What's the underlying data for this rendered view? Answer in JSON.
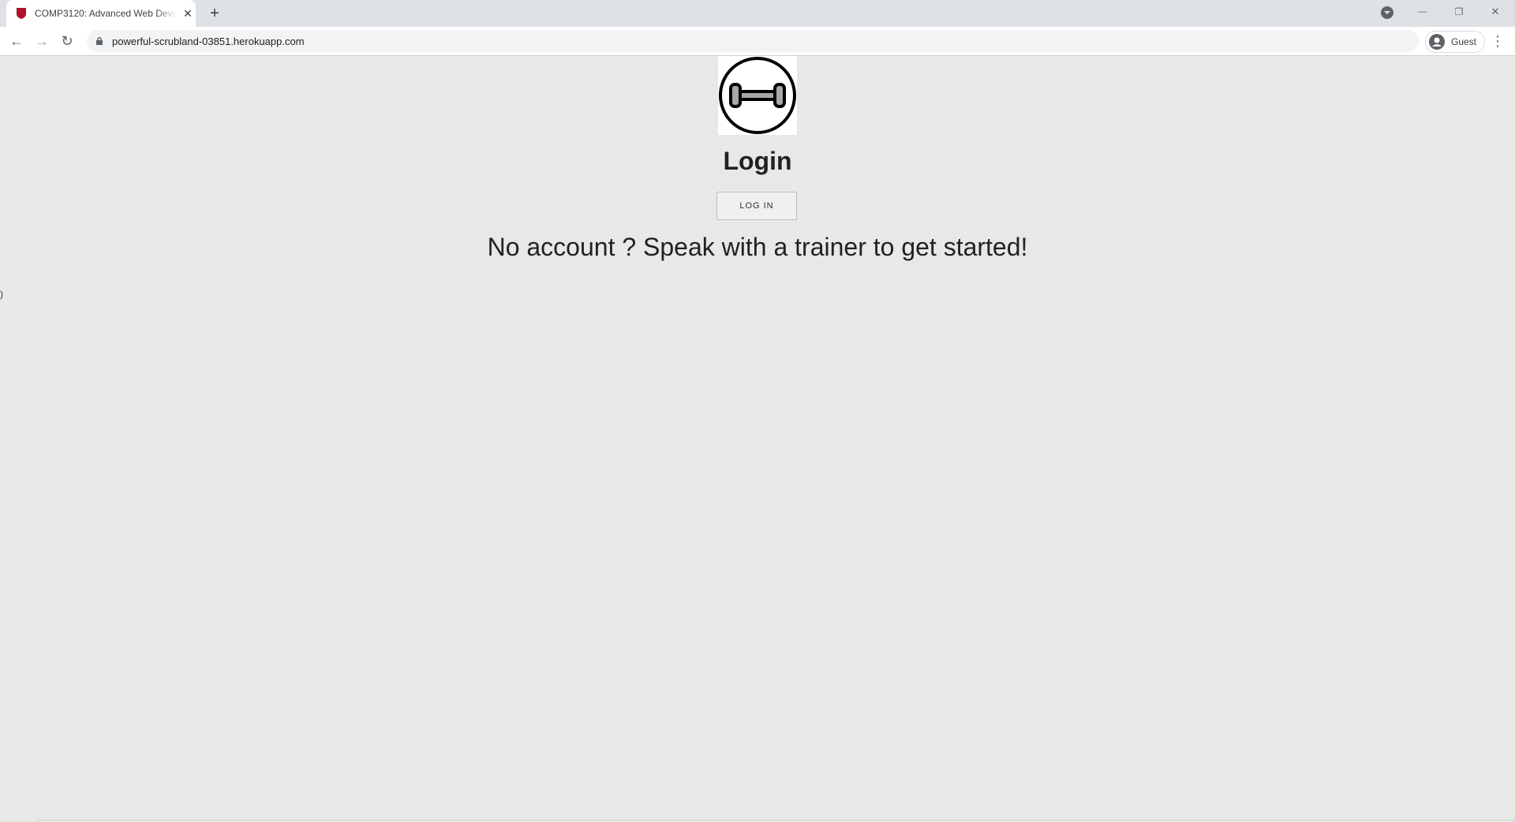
{
  "browser": {
    "tab": {
      "title": "COMP3120: Advanced Web Deve",
      "close": "✕",
      "favicon_color": "#b0122d"
    },
    "new_tab": "+",
    "nav": {
      "back": "←",
      "forward": "→",
      "reload": "↻"
    },
    "url": "powerful-scrubland-03851.herokuapp.com",
    "profile_label": "Guest",
    "menu": "⋮",
    "window": {
      "minimize": "—",
      "restore": "❐",
      "close": "✕"
    }
  },
  "page": {
    "logo_icon": "dumbbell-icon",
    "heading": "Login",
    "login_button": "LOG IN",
    "subtitle": "No account ? Speak with a trainer to get started!",
    "stray_char": ")"
  }
}
